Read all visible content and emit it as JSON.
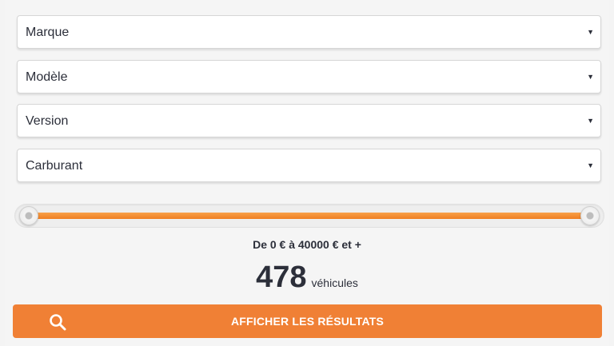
{
  "filters": {
    "brand": {
      "value": "Marque"
    },
    "model": {
      "value": "Modèle"
    },
    "version": {
      "value": "Version"
    },
    "fuel": {
      "value": "Carburant"
    },
    "dropdown_arrow": "▼"
  },
  "price": {
    "min": 0,
    "max": 40000,
    "range_min_fraction": 0.0,
    "range_max_fraction": 1.0,
    "range_text": "De 0 € à 40000 € et +",
    "accent_color": "#f07f22"
  },
  "results": {
    "count": "478",
    "unit": "véhicules"
  },
  "submit": {
    "label": "AFFICHER LES RÉSULTATS",
    "icon": "search-icon",
    "color": "#f08035"
  }
}
